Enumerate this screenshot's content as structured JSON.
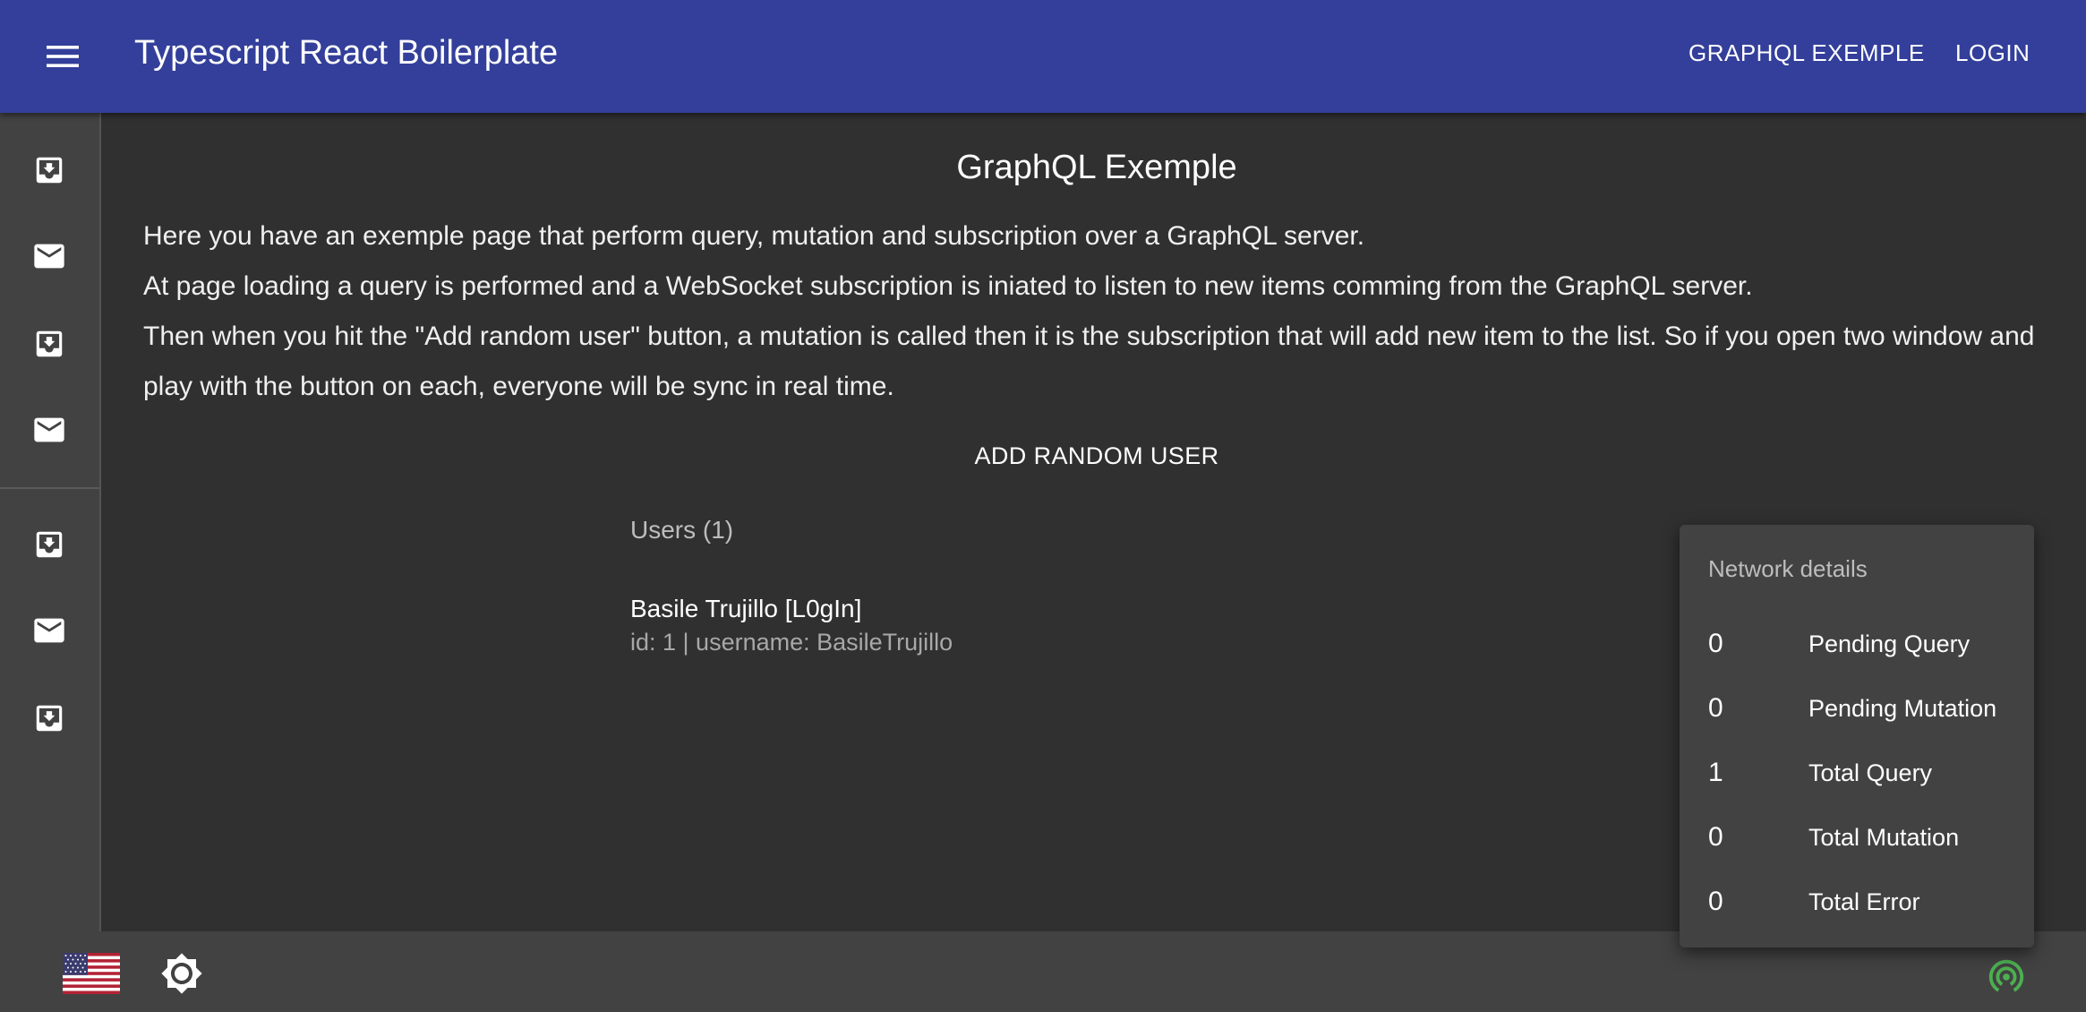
{
  "appbar": {
    "title": "Typescript React Boilerplate",
    "nav": [
      {
        "label": "GRAPHQL EXEMPLE"
      },
      {
        "label": "LOGIN"
      }
    ],
    "background": "#333f9a"
  },
  "sidebar": {
    "items": [
      {
        "icon": "move-to-inbox-icon"
      },
      {
        "icon": "mail-icon"
      },
      {
        "icon": "move-to-inbox-icon"
      },
      {
        "icon": "mail-icon"
      },
      {
        "icon": "move-to-inbox-icon"
      },
      {
        "icon": "mail-icon"
      },
      {
        "icon": "move-to-inbox-icon"
      }
    ]
  },
  "main": {
    "title": "GraphQL Exemple",
    "paragraphs": [
      "Here you have an exemple page that perform query, mutation and subscription over a GraphQL server.",
      "At page loading a query is performed and a WebSocket subscription is iniated to listen to new items comming from the GraphQL server.",
      "Then when you hit the \"Add random user\" button, a mutation is called then it is the subscription that will add new item to the list. So if you open two window and play with the button on each, everyone will be sync in real time."
    ],
    "add_button": "ADD RANDOM USER",
    "users_header": "Users (1)",
    "users": [
      {
        "primary": "Basile Trujillo [L0gIn]",
        "secondary": "id: 1 | username: BasileTrujillo"
      }
    ]
  },
  "network_details": {
    "title": "Network details",
    "rows": [
      {
        "value": "0",
        "label": "Pending Query"
      },
      {
        "value": "0",
        "label": "Pending Mutation"
      },
      {
        "value": "1",
        "label": "Total Query"
      },
      {
        "value": "0",
        "label": "Total Mutation"
      },
      {
        "value": "0",
        "label": "Total Error"
      }
    ]
  },
  "bottombar": {
    "language_icon": "us-flag-icon",
    "theme_icon": "brightness-icon",
    "network_icon": "network-status-icon",
    "network_status_color": "#4caf50"
  }
}
